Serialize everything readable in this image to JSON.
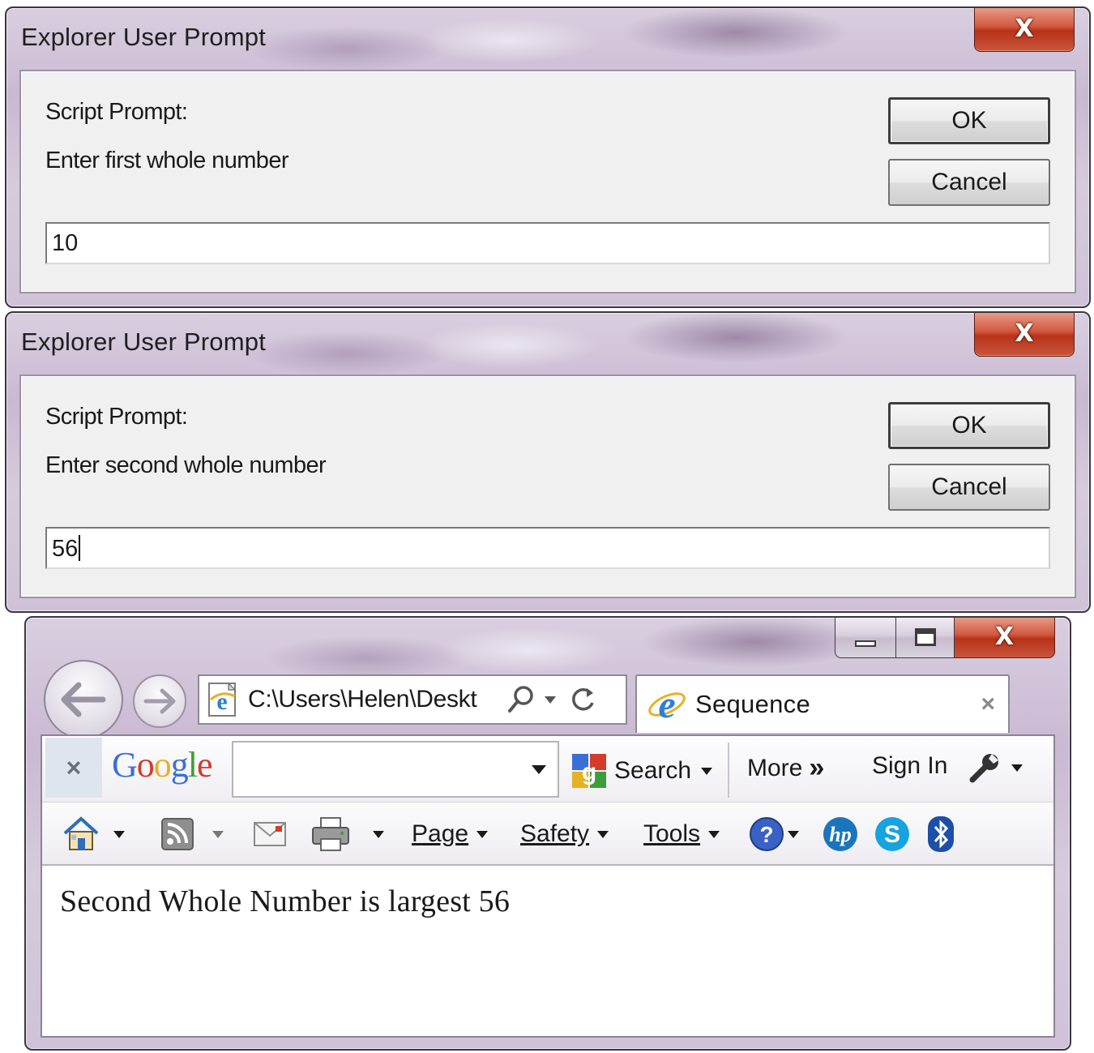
{
  "dialogs": [
    {
      "title": "Explorer User Prompt",
      "close_label": "X",
      "script_label": "Script Prompt:",
      "prompt_text": "Enter first whole number",
      "ok_label": "OK",
      "cancel_label": "Cancel",
      "input_value": "10"
    },
    {
      "title": "Explorer User Prompt",
      "close_label": "X",
      "script_label": "Script Prompt:",
      "prompt_text": "Enter second whole number",
      "ok_label": "OK",
      "cancel_label": "Cancel",
      "input_value": "56"
    }
  ],
  "browser": {
    "address": "C:\\Users\\Helen\\Deskt",
    "tab_title": "Sequence",
    "tab_close": "×",
    "close_label": "X",
    "google_bar": {
      "close": "×",
      "logo": {
        "G": "G",
        "o1": "o",
        "o2": "o",
        "g": "g",
        "l": "l",
        "e": "e"
      },
      "search_label": "Search",
      "more_label": "More",
      "more_arrows": "»",
      "signin_label": "Sign In"
    },
    "command_bar": {
      "page_label": "Page",
      "safety_label": "Safety",
      "tools_label": "Tools"
    },
    "page_content": "Second Whole Number is largest 56"
  },
  "colors": {
    "close_red": "#c9553b",
    "google_blue": "#3b6fd8",
    "google_red": "#d43b2a",
    "google_yellow": "#e7b126",
    "google_green": "#3f9c3a",
    "ie_blue": "#2e7fd6",
    "skype_blue": "#17a3e0",
    "hp_blue": "#1b75bc",
    "bluetooth_blue": "#1d4fa8"
  },
  "icons": [
    "back-arrow-icon",
    "forward-arrow-icon",
    "ie-page-icon",
    "search-magnifier-icon",
    "refresh-icon",
    "ie-logo-icon",
    "google-search-icon",
    "wrench-icon",
    "home-icon",
    "rss-feed-icon",
    "mail-icon",
    "printer-icon",
    "help-icon",
    "hp-icon",
    "skype-icon",
    "bluetooth-icon"
  ]
}
